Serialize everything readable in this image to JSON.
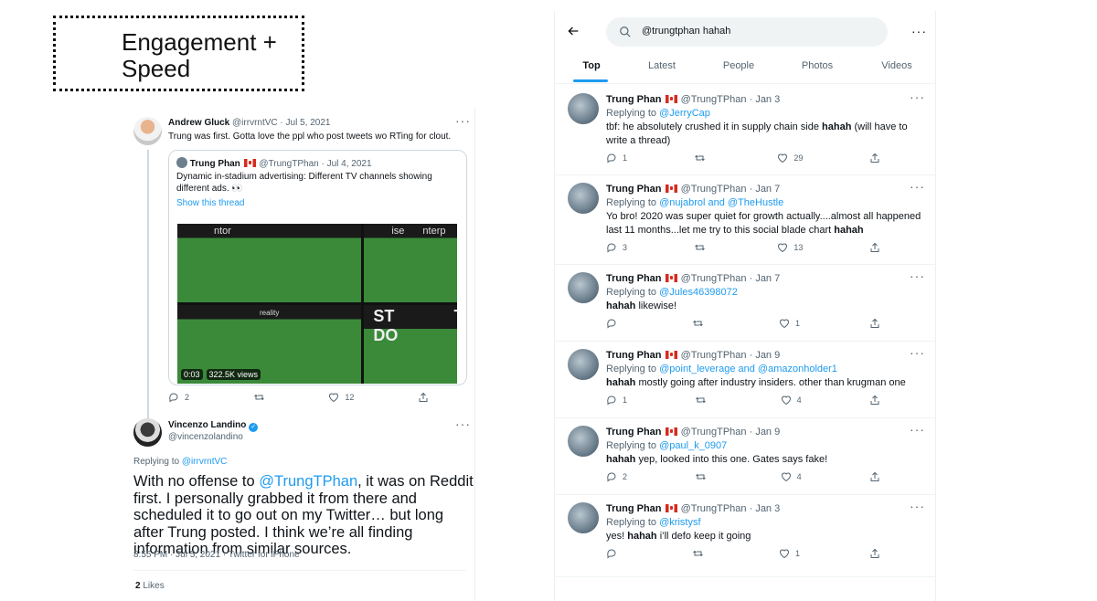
{
  "slide": {
    "title": "Engagement + Speed"
  },
  "left": {
    "tweet1": {
      "name": "Andrew Gluck",
      "handle": "@irrvrntVC",
      "date": "· Jul 5, 2021",
      "text": "Trung was first. Gotta love the ppl who post tweets wo RTing for clout.",
      "quote": {
        "name": "Trung Phan",
        "handle": "@TrungTPhan",
        "date": "· Jul 4, 2021",
        "text": "Dynamic in-stadium advertising: Different TV channels showing different ads. 👀",
        "show_thread": "Show this thread",
        "video_time": "0:03",
        "video_views": "322.5K views",
        "banners": [
          "ntor",
          "ise",
          "nterp",
          "reality",
          "ST DO",
          "T"
        ]
      },
      "replies": "2",
      "likes": "12"
    },
    "tweet2": {
      "name": "Vincenzo Landino",
      "handle": "@vincenzolandino",
      "replying_label": "Replying to",
      "replying_to": "@irrvrntVC",
      "text_before": "With no offense to ",
      "mention": "@TrungTPhan",
      "text_after": ", it was on Reddit first. I personally grabbed it from there and scheduled it to go out on my Twitter… but long after Trung posted. I think we’re all finding information from similar sources.",
      "meta": "8:55 PM · Jul 5, 2021 · Twitter for iPhone",
      "likes_count": "2",
      "likes_label": "Likes"
    }
  },
  "right": {
    "search": {
      "query": "@trungtphan hahah"
    },
    "tabs": [
      "Top",
      "Latest",
      "People",
      "Photos",
      "Videos"
    ],
    "active_tab": "Top",
    "tweets": [
      {
        "name": "Trung Phan",
        "handle": "@TrungTPhan",
        "date": "· Jan 3",
        "replying_label": "Replying to",
        "replying_to": "@JerryCap",
        "pre": "tbf: he absolutely crushed it in supply chain side ",
        "bold": "hahah",
        "post": " (will have to write a thread)",
        "replies": "1",
        "retweets": "",
        "likes": "29"
      },
      {
        "name": "Trung Phan",
        "handle": "@TrungTPhan",
        "date": "· Jan 7",
        "replying_label": "Replying to",
        "replying_to": "@nujabrol and @TheHustle",
        "pre": "Yo bro! 2020 was super quiet for growth actually....almost all happened last 11 months...let me try to this social blade chart ",
        "bold": "hahah",
        "post": "",
        "replies": "3",
        "retweets": "",
        "likes": "13"
      },
      {
        "name": "Trung Phan",
        "handle": "@TrungTPhan",
        "date": "· Jan 7",
        "replying_label": "Replying to",
        "replying_to": "@Jules46398072",
        "pre": "",
        "bold": "hahah",
        "post": " likewise!",
        "replies": "",
        "retweets": "",
        "likes": "1"
      },
      {
        "name": "Trung Phan",
        "handle": "@TrungTPhan",
        "date": "· Jan 9",
        "replying_label": "Replying to",
        "replying_to": "@point_leverage and @amazonholder1",
        "pre": "",
        "bold": "hahah",
        "post": " mostly going after industry insiders. other than krugman one",
        "replies": "1",
        "retweets": "",
        "likes": "4"
      },
      {
        "name": "Trung Phan",
        "handle": "@TrungTPhan",
        "date": "· Jan 9",
        "replying_label": "Replying to",
        "replying_to": "@paul_k_0907",
        "pre": "",
        "bold": "hahah",
        "post": " yep, looked into this one. Gates says fake!",
        "replies": "2",
        "retweets": "",
        "likes": "4"
      },
      {
        "name": "Trung Phan",
        "handle": "@TrungTPhan",
        "date": "· Jan 3",
        "replying_label": "Replying to",
        "replying_to": "@kristysf",
        "pre": "yes! ",
        "bold": "hahah",
        "post": " i’ll defo keep it going",
        "replies": "",
        "retweets": "",
        "likes": "1"
      }
    ]
  }
}
